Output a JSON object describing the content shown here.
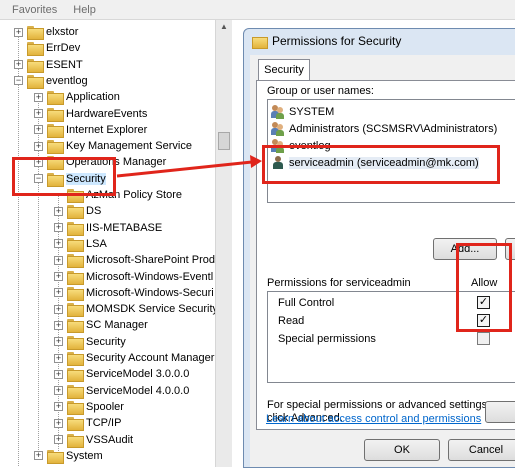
{
  "menubar": {
    "items": [
      "Favorites",
      "Help"
    ]
  },
  "tree": {
    "items": [
      {
        "label": "elxstor",
        "expander": "+",
        "level": 1
      },
      {
        "label": "ErrDev",
        "expander": "",
        "level": 1
      },
      {
        "label": "ESENT",
        "expander": "+",
        "level": 1
      },
      {
        "label": "eventlog",
        "expander": "−",
        "level": 1
      },
      {
        "label": "Application",
        "expander": "+",
        "level": 2
      },
      {
        "label": "HardwareEvents",
        "expander": "+",
        "level": 2
      },
      {
        "label": "Internet Explorer",
        "expander": "+",
        "level": 2
      },
      {
        "label": "Key Management Service",
        "expander": "+",
        "level": 2
      },
      {
        "label": "Operations Manager",
        "expander": "+",
        "level": 2
      },
      {
        "label": "Security",
        "expander": "−",
        "level": 2,
        "selected": true
      },
      {
        "label": "AzMan Policy Store",
        "expander": "",
        "level": 3
      },
      {
        "label": "DS",
        "expander": "+",
        "level": 3
      },
      {
        "label": "IIS-METABASE",
        "expander": "+",
        "level": 3
      },
      {
        "label": "LSA",
        "expander": "+",
        "level": 3
      },
      {
        "label": "Microsoft-SharePoint Prod",
        "expander": "+",
        "level": 3
      },
      {
        "label": "Microsoft-Windows-Eventl",
        "expander": "+",
        "level": 3
      },
      {
        "label": "Microsoft-Windows-Securi",
        "expander": "+",
        "level": 3
      },
      {
        "label": "MOMSDK Service Security",
        "expander": "+",
        "level": 3
      },
      {
        "label": "SC Manager",
        "expander": "+",
        "level": 3
      },
      {
        "label": "Security",
        "expander": "+",
        "level": 3
      },
      {
        "label": "Security Account Manager",
        "expander": "+",
        "level": 3
      },
      {
        "label": "ServiceModel 3.0.0.0",
        "expander": "+",
        "level": 3
      },
      {
        "label": "ServiceModel 4.0.0.0",
        "expander": "+",
        "level": 3
      },
      {
        "label": "Spooler",
        "expander": "+",
        "level": 3
      },
      {
        "label": "TCP/IP",
        "expander": "+",
        "level": 3
      },
      {
        "label": "VSSAudit",
        "expander": "+",
        "level": 3
      },
      {
        "label": "System",
        "expander": "+",
        "level": 2
      }
    ]
  },
  "dialog": {
    "title": "Permissions for Security",
    "tab": "Security",
    "group_label": "Group or user names:",
    "users": [
      {
        "name": "SYSTEM",
        "icon": "users-icon"
      },
      {
        "name": "Administrators (SCSMSRV\\Administrators)",
        "icon": "users-icon"
      },
      {
        "name": "eventlog",
        "icon": "users-icon"
      },
      {
        "name": "serviceadmin (serviceadmin@mk.com)",
        "icon": "user-icon",
        "selected": true
      }
    ],
    "add_button": "Add...",
    "permissions_label": "Permissions for serviceadmin",
    "allow_header": "Allow",
    "permissions": [
      {
        "name": "Full Control",
        "allow": true
      },
      {
        "name": "Read",
        "allow": true
      },
      {
        "name": "Special permissions",
        "allow": false
      }
    ],
    "advanced_text_1": "For special permissions or advanced settings,",
    "advanced_text_2": "click Advanced.",
    "learn_link": "Learn about access control and permissions",
    "ok_button": "OK",
    "cancel_button": "Cancel"
  },
  "colors": {
    "annotation": "#e0251b",
    "link": "#0066cc"
  }
}
